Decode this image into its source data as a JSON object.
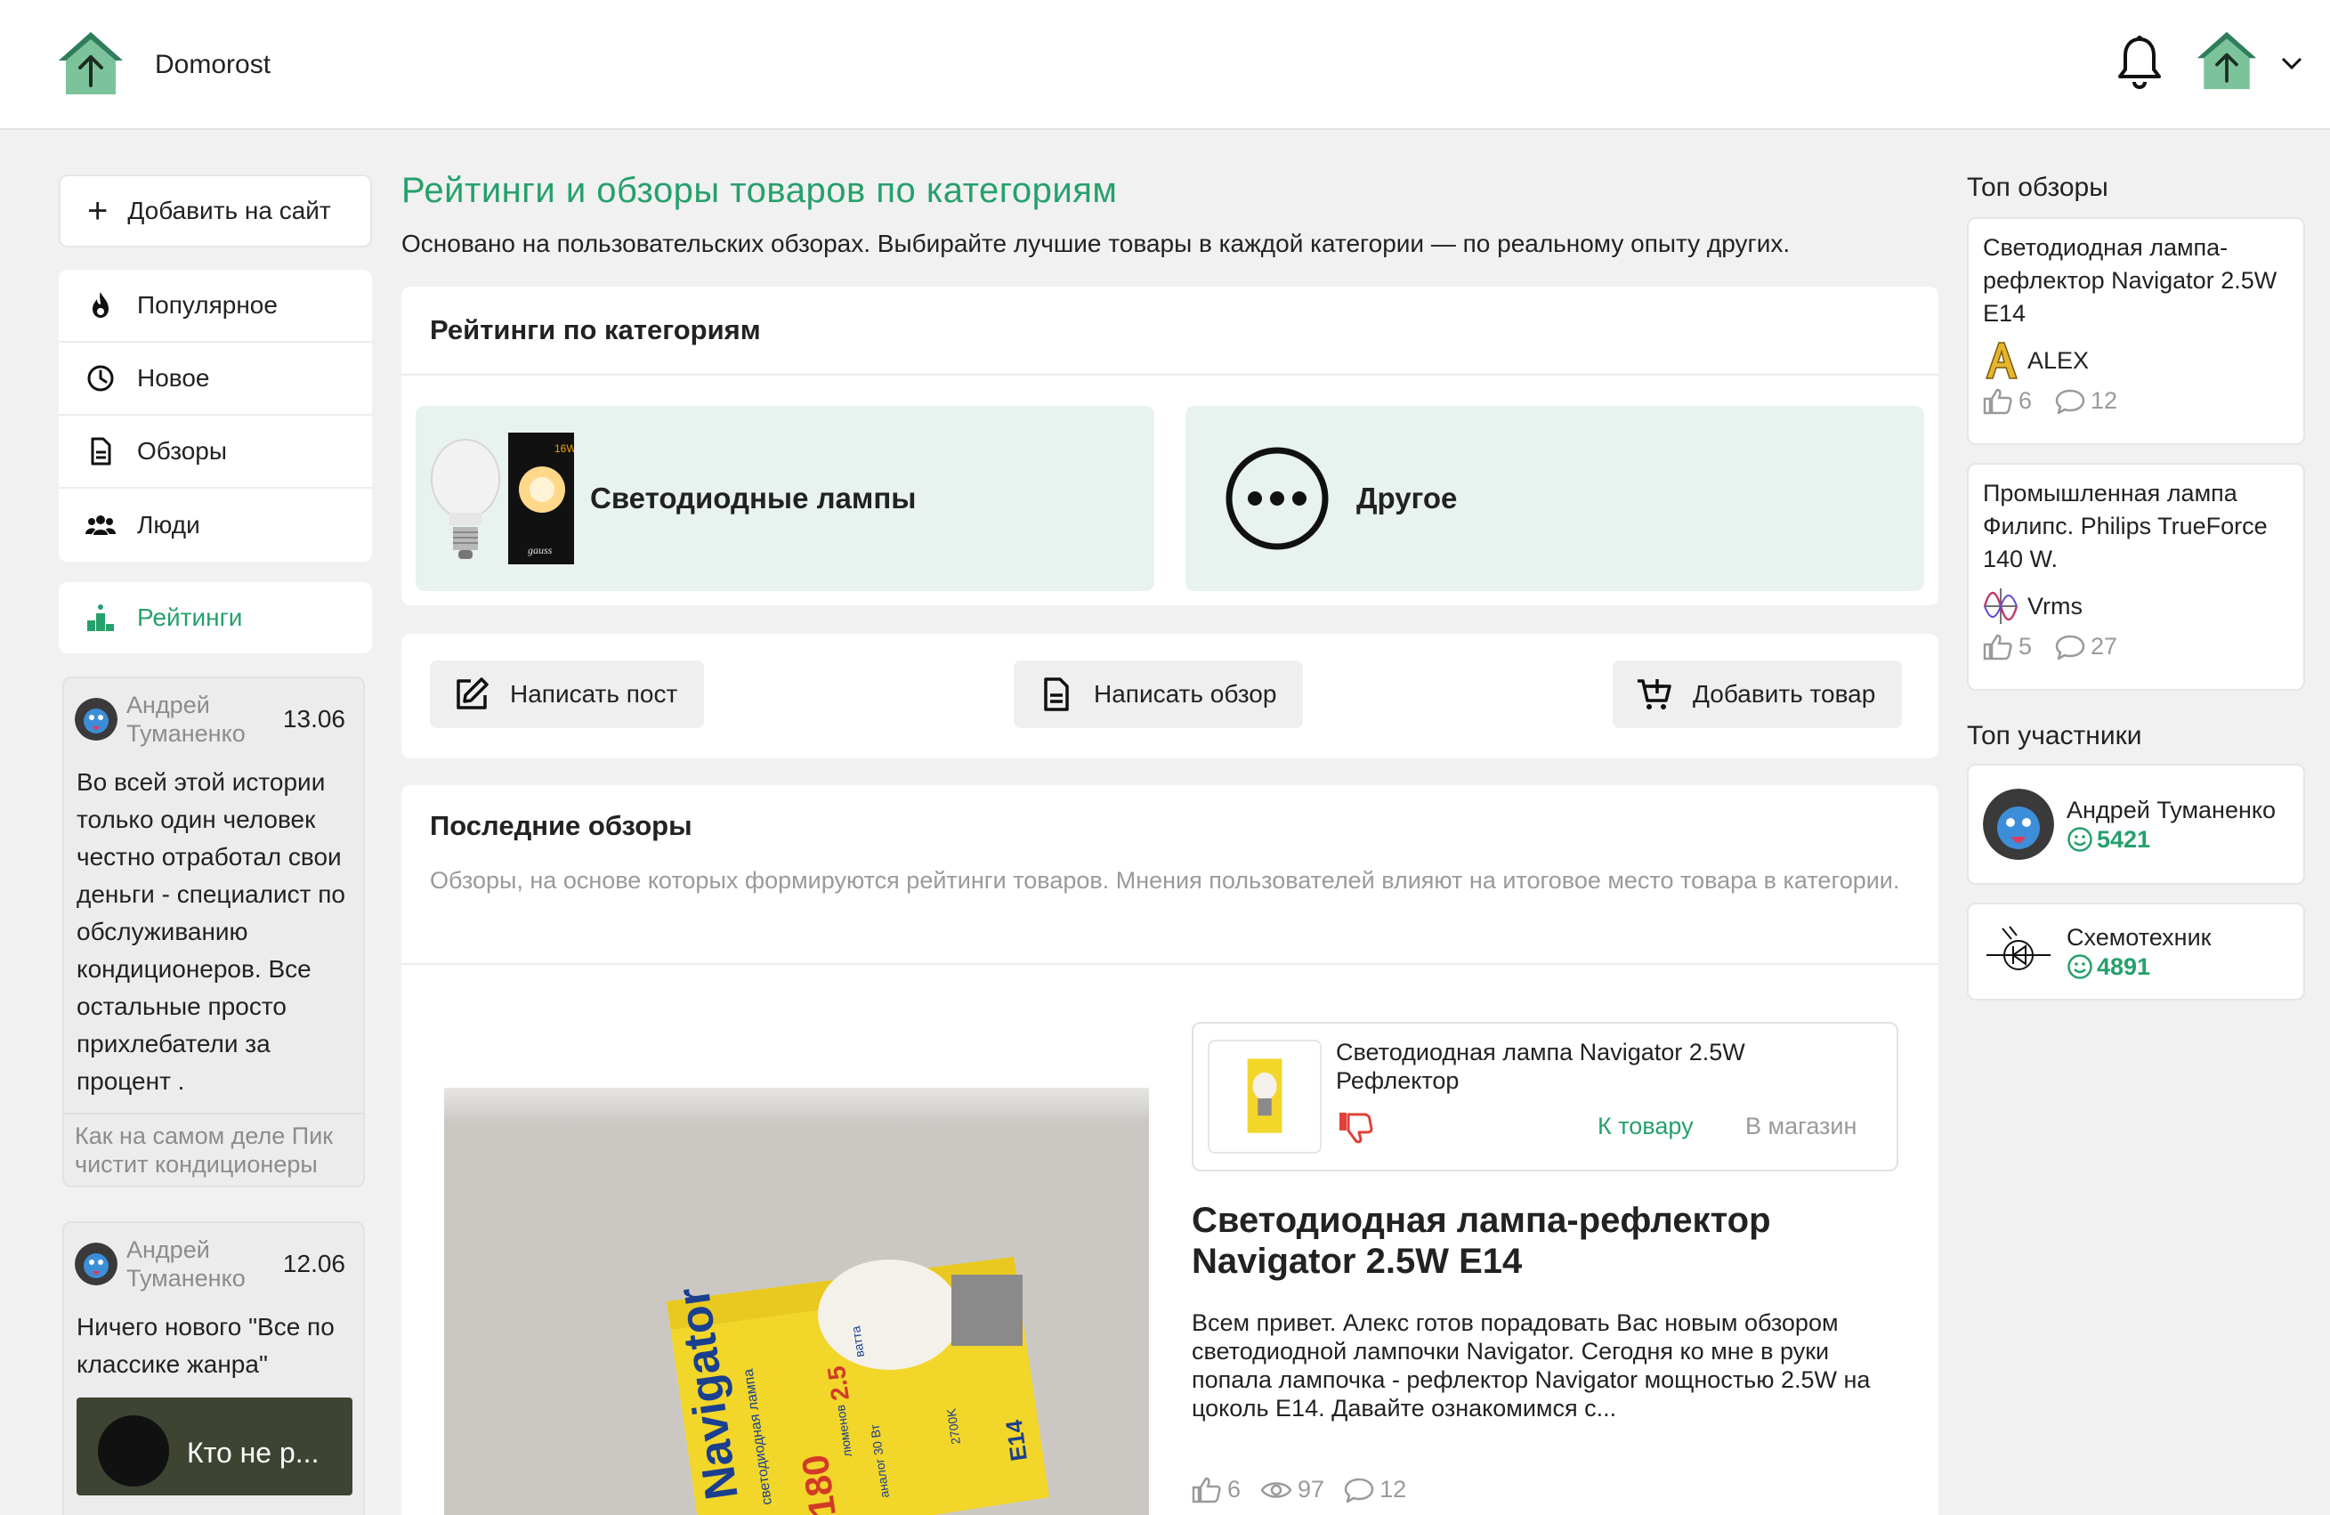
{
  "header": {
    "brand": "Domorost"
  },
  "left": {
    "add_button": "Добавить на сайт",
    "nav": [
      {
        "label": "Популярное",
        "icon": "fire-icon"
      },
      {
        "label": "Новое",
        "icon": "clock-icon"
      },
      {
        "label": "Обзоры",
        "icon": "document-icon"
      },
      {
        "label": "Люди",
        "icon": "people-icon"
      }
    ],
    "ratings": "Рейтинги",
    "feed": [
      {
        "author": "Андрей Туманенко",
        "date": "13.06",
        "text": "Во всей этой истории только один человек честно отработал свои деньги - специалист по обслуживанию кондиционеров. Все остальные просто прихлебатели за процент .",
        "link": "Как на самом деле Пик чистит кондиционеры"
      },
      {
        "author": "Андрей Туманенко",
        "date": "12.06",
        "text": "Ничего нового \"Все по классике жанра\"",
        "video_title": "Кто не р..."
      }
    ]
  },
  "main": {
    "title": "Рейтинги и обзоры товаров по категориям",
    "subtitle": "Основано на пользовательских обзорах. Выбирайте лучшие товары в каждой категории — по реальному опыту других.",
    "categories_header": "Рейтинги по категориям",
    "categories": [
      {
        "label": "Светодиодные лампы"
      },
      {
        "label": "Другое"
      }
    ],
    "actions": {
      "write_post": "Написать пост",
      "write_review": "Написать обзор",
      "add_product": "Добавить товар"
    },
    "reviews": {
      "title": "Последние обзоры",
      "description": "Обзоры, на основе которых формируются рейтинги товаров. Мнения пользователей влияют на итоговое место товара в категории.",
      "item": {
        "product_name": "Светодиодная лампа Navigator 2.5W Рефлектор",
        "to_product": "К товару",
        "to_store": "В магазин",
        "title": "Светодиодная лампа-рефлектор Navigator 2.5W E14",
        "body": "Всем привет. Алекс готов порадовать Вас новым обзором светодиодной лампочки Navigator. Сегодня ко мне в руки попала лампочка - рефлектор Navigator мощностью 2.5W на цоколь E14. Давайте ознакомимся с...",
        "likes": "6",
        "views": "97",
        "comments": "12",
        "photo_text": {
          "brand": "Navigator",
          "kind": "светодиодная лампа",
          "lumens": "180",
          "lumens_label": "люменов",
          "watts": "2.5",
          "watts_label": "ватта",
          "equiv": "аналог 30 Вт",
          "kelvin": "2700K",
          "socket": "E14"
        }
      }
    }
  },
  "right": {
    "top_reviews_title": "Топ обзоры",
    "top_reviews": [
      {
        "title": "Светодиодная лампа-рефлектор Navigator 2.5W E14",
        "author": "ALEX",
        "likes": "6",
        "comments": "12"
      },
      {
        "title": "Промышленная лампа Филипс. Philips TrueForce 140 W.",
        "author": "Vrms",
        "likes": "5",
        "comments": "27"
      }
    ],
    "top_users_title": "Топ участники",
    "top_users": [
      {
        "name": "Андрей Туманенко",
        "score": "5421"
      },
      {
        "name": "Схемотехник",
        "score": "4891"
      }
    ]
  },
  "colors": {
    "accent": "#26a06b",
    "logo": "#7cc39b",
    "tile_bg": "#e8f2ee",
    "dislike": "#e0413a"
  }
}
